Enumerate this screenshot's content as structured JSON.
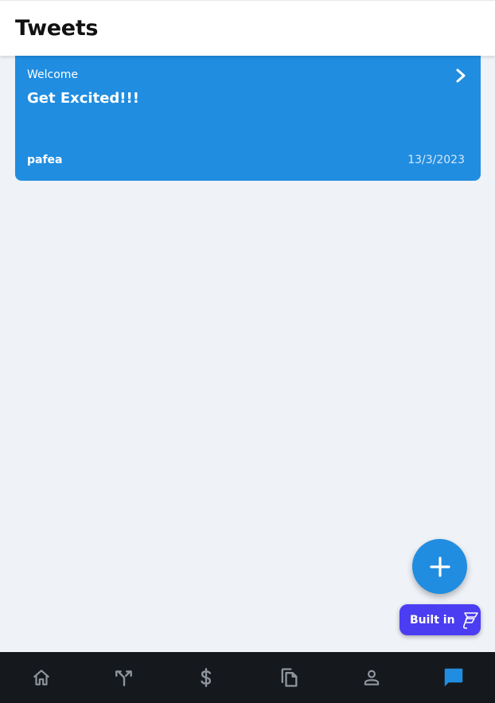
{
  "header": {
    "title": "Tweets"
  },
  "tweets": [
    {
      "subtitle": "Welcome",
      "title": "Get Excited!!!",
      "author": "pafea",
      "date": "13/3/2023",
      "icon": "chevron-right-icon"
    }
  ],
  "fab": {
    "icon": "plus-icon"
  },
  "badge": {
    "label": "Built in",
    "icon": "flutterflow-logo-icon"
  },
  "navbar": {
    "items": [
      {
        "id": "home",
        "icon": "home-icon"
      },
      {
        "id": "merge",
        "icon": "merge-arrows-icon"
      },
      {
        "id": "payments",
        "icon": "dollar-icon"
      },
      {
        "id": "documents",
        "icon": "copy-icon"
      },
      {
        "id": "profile",
        "icon": "person-icon"
      },
      {
        "id": "tweets",
        "icon": "chat-icon",
        "active": true
      }
    ]
  },
  "colors": {
    "accent": "#208de0",
    "background": "#eff2f7",
    "navbar": "#15181c",
    "nav_inactive": "#8e959e",
    "badge": "#4b3df2"
  }
}
